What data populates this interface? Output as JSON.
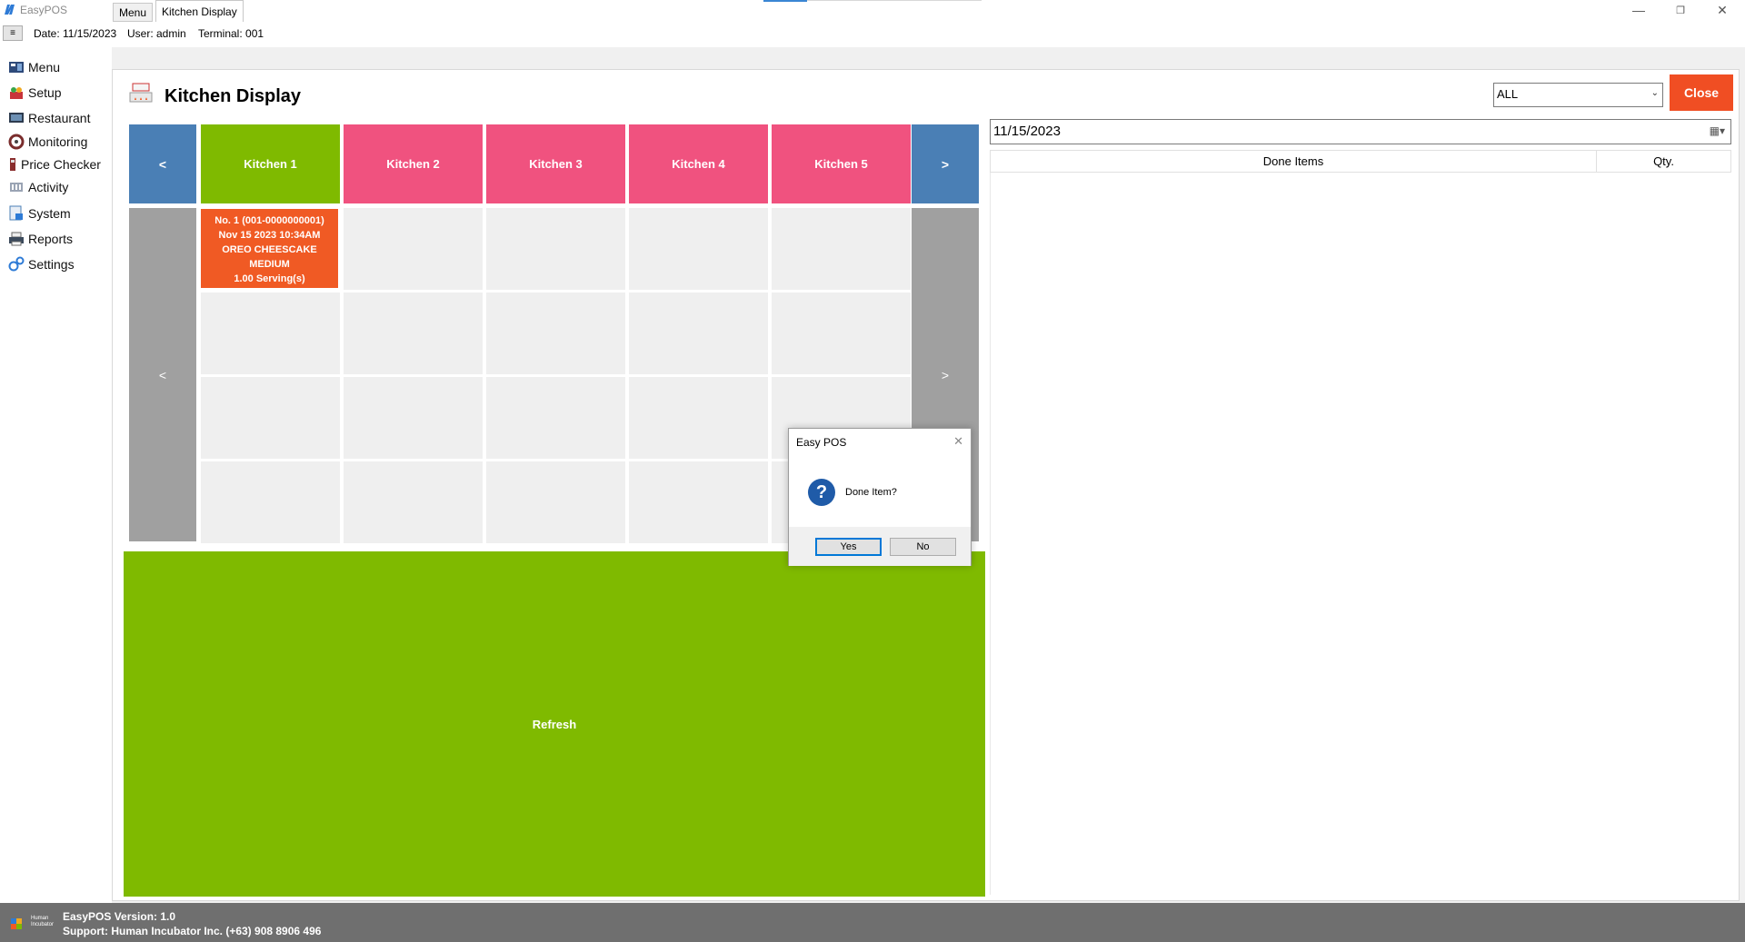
{
  "window": {
    "title": "EasyPOS",
    "accent": "#3a86d4"
  },
  "infobar": {
    "menu_button": "≡",
    "date": "Date: 11/15/2023",
    "user": "User: admin",
    "terminal": "Terminal: 001"
  },
  "sidebar": {
    "items": [
      {
        "label": "Menu",
        "icon": "menu-icon"
      },
      {
        "label": "Setup",
        "icon": "setup-icon"
      },
      {
        "label": "Restaurant",
        "icon": "restaurant-icon"
      },
      {
        "label": "Monitoring",
        "icon": "monitoring-icon"
      },
      {
        "label": "Price Checker",
        "icon": "price-checker-icon"
      },
      {
        "label": "Activity",
        "icon": "activity-icon"
      },
      {
        "label": "System",
        "icon": "system-icon"
      },
      {
        "label": "Reports",
        "icon": "printer-icon"
      },
      {
        "label": "Settings",
        "icon": "settings-icon"
      }
    ]
  },
  "tabs": [
    {
      "label": "Menu",
      "active": false
    },
    {
      "label": "Kitchen Display",
      "active": true
    }
  ],
  "page": {
    "title": "Kitchen Display",
    "filter_value": "ALL",
    "close_label": "Close",
    "close_color": "#f04e23"
  },
  "kitchens": {
    "prev_label": "<",
    "next_label": ">",
    "headers": [
      {
        "label": "Kitchen 1",
        "color": "#7fba00"
      },
      {
        "label": "Kitchen 2",
        "color": "#f0527f"
      },
      {
        "label": "Kitchen 3",
        "color": "#f0527f"
      },
      {
        "label": "Kitchen 4",
        "color": "#f0527f"
      },
      {
        "label": "Kitchen 5",
        "color": "#f0527f"
      }
    ],
    "row_prev_label": "<",
    "row_next_label": ">"
  },
  "order": {
    "number": "No. 1 (001-0000000001)",
    "datetime": "Nov 15 2023 10:34AM",
    "item": "OREO CHEESCAKE",
    "size": "MEDIUM",
    "qty": "1.00 Serving(s)",
    "color": "#f05a24"
  },
  "refresh_label": "Refresh",
  "done_items": {
    "date": "11/15/2023",
    "columns": [
      "Done Items",
      "Qty."
    ],
    "rows": []
  },
  "dialog": {
    "title": "Easy POS",
    "message": "Done Item?",
    "yes_label": "Yes",
    "no_label": "No"
  },
  "statusbar": {
    "version": "EasyPOS Version: 1.0",
    "support": "Support: Human Incubator Inc. (+63) 908 8906 496",
    "logo_text": "Human Incubator"
  }
}
